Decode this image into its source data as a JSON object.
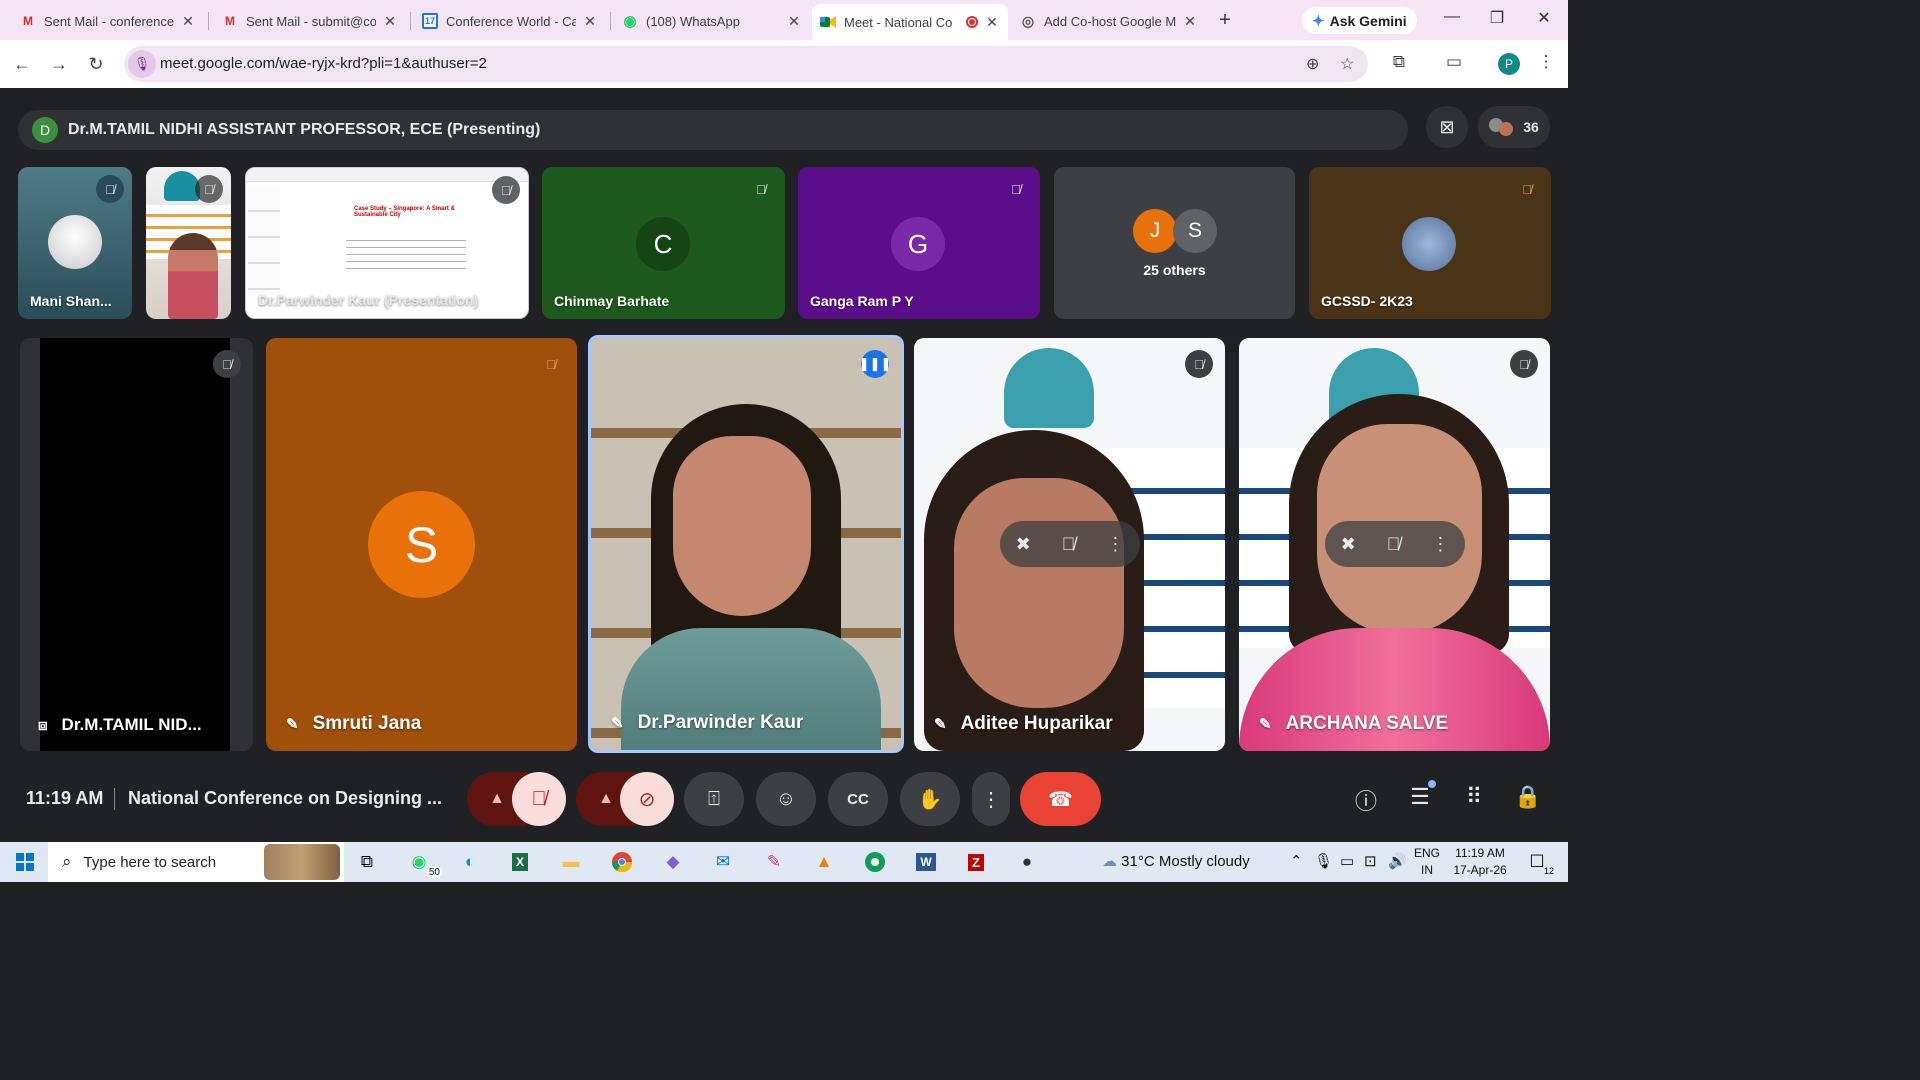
{
  "browser": {
    "tabs": [
      {
        "title": "Sent Mail - conferencev",
        "icon": "gmail-icon",
        "close": "✕"
      },
      {
        "title": "Sent Mail - submit@co",
        "icon": "gmail-icon",
        "close": "✕"
      },
      {
        "title": "Conference World - Cal",
        "icon": "calendar-icon",
        "close": "✕"
      },
      {
        "title": "(108) WhatsApp",
        "icon": "whatsapp-icon",
        "close": "✕"
      },
      {
        "title": "Meet - National Co",
        "icon": "meet-icon",
        "close": "✕",
        "active": true
      },
      {
        "title": "Add Co-host Google M",
        "icon": "globe-icon",
        "close": "✕"
      }
    ],
    "new_tab": "+",
    "ask_gemini": "Ask Gemini",
    "url": "meet.google.com/wae-ryjx-krd?pli=1&authuser=2",
    "profile_initial": "P"
  },
  "meet": {
    "presenting_initial": "D",
    "presenting_text": "Dr.M.TAMIL NIDHI ASSISTANT PROFESSOR, ECE (Presenting)",
    "participant_count": "36",
    "top_tiles": [
      {
        "name": "Mani Shan..."
      },
      {
        "name": ""
      },
      {
        "name": "Dr.Parwinder Kaur (Presentation)"
      },
      {
        "name": "Chinmay Barhate",
        "initial": "C"
      },
      {
        "name": "Ganga Ram P Y",
        "initial": "G"
      },
      {
        "name": "25 others",
        "initials": [
          "J",
          "S"
        ]
      },
      {
        "name": "GCSSD- 2K23"
      }
    ],
    "slide": {
      "title": "Case Study – Singapore: A Smart & Sustainable City"
    },
    "main_tiles": [
      {
        "name": "Dr.M.TAMIL NID..."
      },
      {
        "name": "Smruti Jana",
        "initial": "S"
      },
      {
        "name": "Dr.Parwinder Kaur"
      },
      {
        "name": "Aditee Huparikar"
      },
      {
        "name": "ARCHANA SALVE"
      }
    ],
    "time": "11:19 AM",
    "meeting_title": "National Conference on Designing ..."
  },
  "taskbar": {
    "search_placeholder": "Type here to search",
    "whatsapp_badge": "50",
    "weather": "31°C  Mostly cloudy",
    "lang_1": "ENG",
    "lang_2": "IN",
    "clock_time": "11:19 AM",
    "clock_date": "17-Apr-26",
    "notif_count": "12"
  },
  "colors": {
    "chinmay_bg": "#1e5a1e",
    "ganga_bg": "#5c0e8a",
    "smruti_bg": "#a0500a",
    "active_speaker_border": "#a8c7fa",
    "hangup": "#ea4335"
  }
}
